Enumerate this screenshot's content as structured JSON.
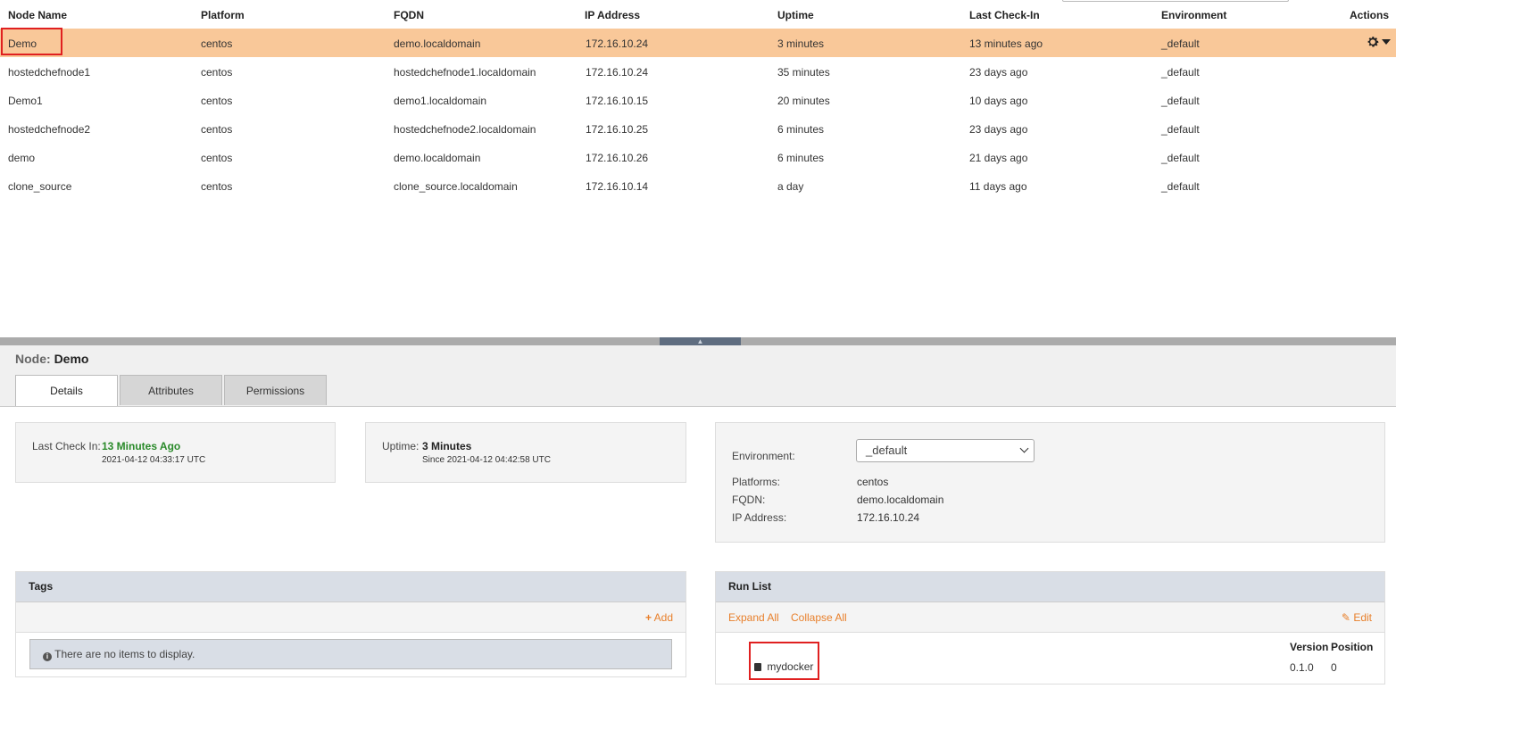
{
  "table": {
    "headers": [
      "Node Name",
      "Platform",
      "FQDN",
      "IP Address",
      "Uptime",
      "Last Check-In",
      "Environment",
      "Actions"
    ],
    "rows": [
      [
        "Demo",
        "centos",
        "demo.localdomain",
        "172.16.10.24",
        "3 minutes",
        "13 minutes ago",
        "_default"
      ],
      [
        "hostedchefnode1",
        "centos",
        "hostedchefnode1.localdomain",
        "172.16.10.24",
        "35 minutes",
        "23 days ago",
        "_default"
      ],
      [
        "Demo1",
        "centos",
        "demo1.localdomain",
        "172.16.10.15",
        "20 minutes",
        "10 days ago",
        "_default"
      ],
      [
        "hostedchefnode2",
        "centos",
        "hostedchefnode2.localdomain",
        "172.16.10.25",
        "6 minutes",
        "23 days ago",
        "_default"
      ],
      [
        "demo",
        "centos",
        "demo.localdomain",
        "172.16.10.26",
        "6 minutes",
        "21 days ago",
        "_default"
      ],
      [
        "clone_source",
        "centos",
        "clone_source.localdomain",
        "172.16.10.14",
        "a day",
        "11 days ago",
        "_default"
      ]
    ],
    "selected_row": 0,
    "actions_icon": "gear-icon"
  },
  "splitter": {
    "handle_glyph": "▲"
  },
  "node": {
    "label": "Node:",
    "name": "Demo"
  },
  "tabs": [
    "Details",
    "Attributes",
    "Permissions"
  ],
  "active_tab": "Details",
  "checkin": {
    "label": "Last Check In:",
    "value": "13 Minutes Ago",
    "timestamp": "2021-04-12 04:33:17 UTC"
  },
  "uptime": {
    "label": "Uptime:",
    "value": "3 Minutes",
    "since": "Since 2021-04-12 04:42:58 UTC"
  },
  "info": {
    "environment_label": "Environment:",
    "environment_value": "_default",
    "platforms_label": "Platforms:",
    "platforms_value": "centos",
    "fqdn_label": "FQDN:",
    "fqdn_value": "demo.localdomain",
    "ip_label": "IP Address:",
    "ip_value": "172.16.10.24"
  },
  "tags": {
    "title": "Tags",
    "add_label": "Add",
    "add_icon": "plus-icon",
    "empty_text": "There are no items to display.",
    "empty_icon": "info-icon"
  },
  "runlist": {
    "title": "Run List",
    "expand_label": "Expand All",
    "collapse_label": "Collapse All",
    "edit_label": "Edit",
    "edit_icon": "edit-icon",
    "version_header": "Version",
    "position_header": "Position",
    "item": {
      "name": "mydocker",
      "icon": "book-icon",
      "version": "0.1.0",
      "position": "0"
    }
  },
  "colors": {
    "selected_row": "#f9c899",
    "accent_orange": "#e8802c",
    "green": "#2a8a2a",
    "highlight_red": "#e02020"
  }
}
